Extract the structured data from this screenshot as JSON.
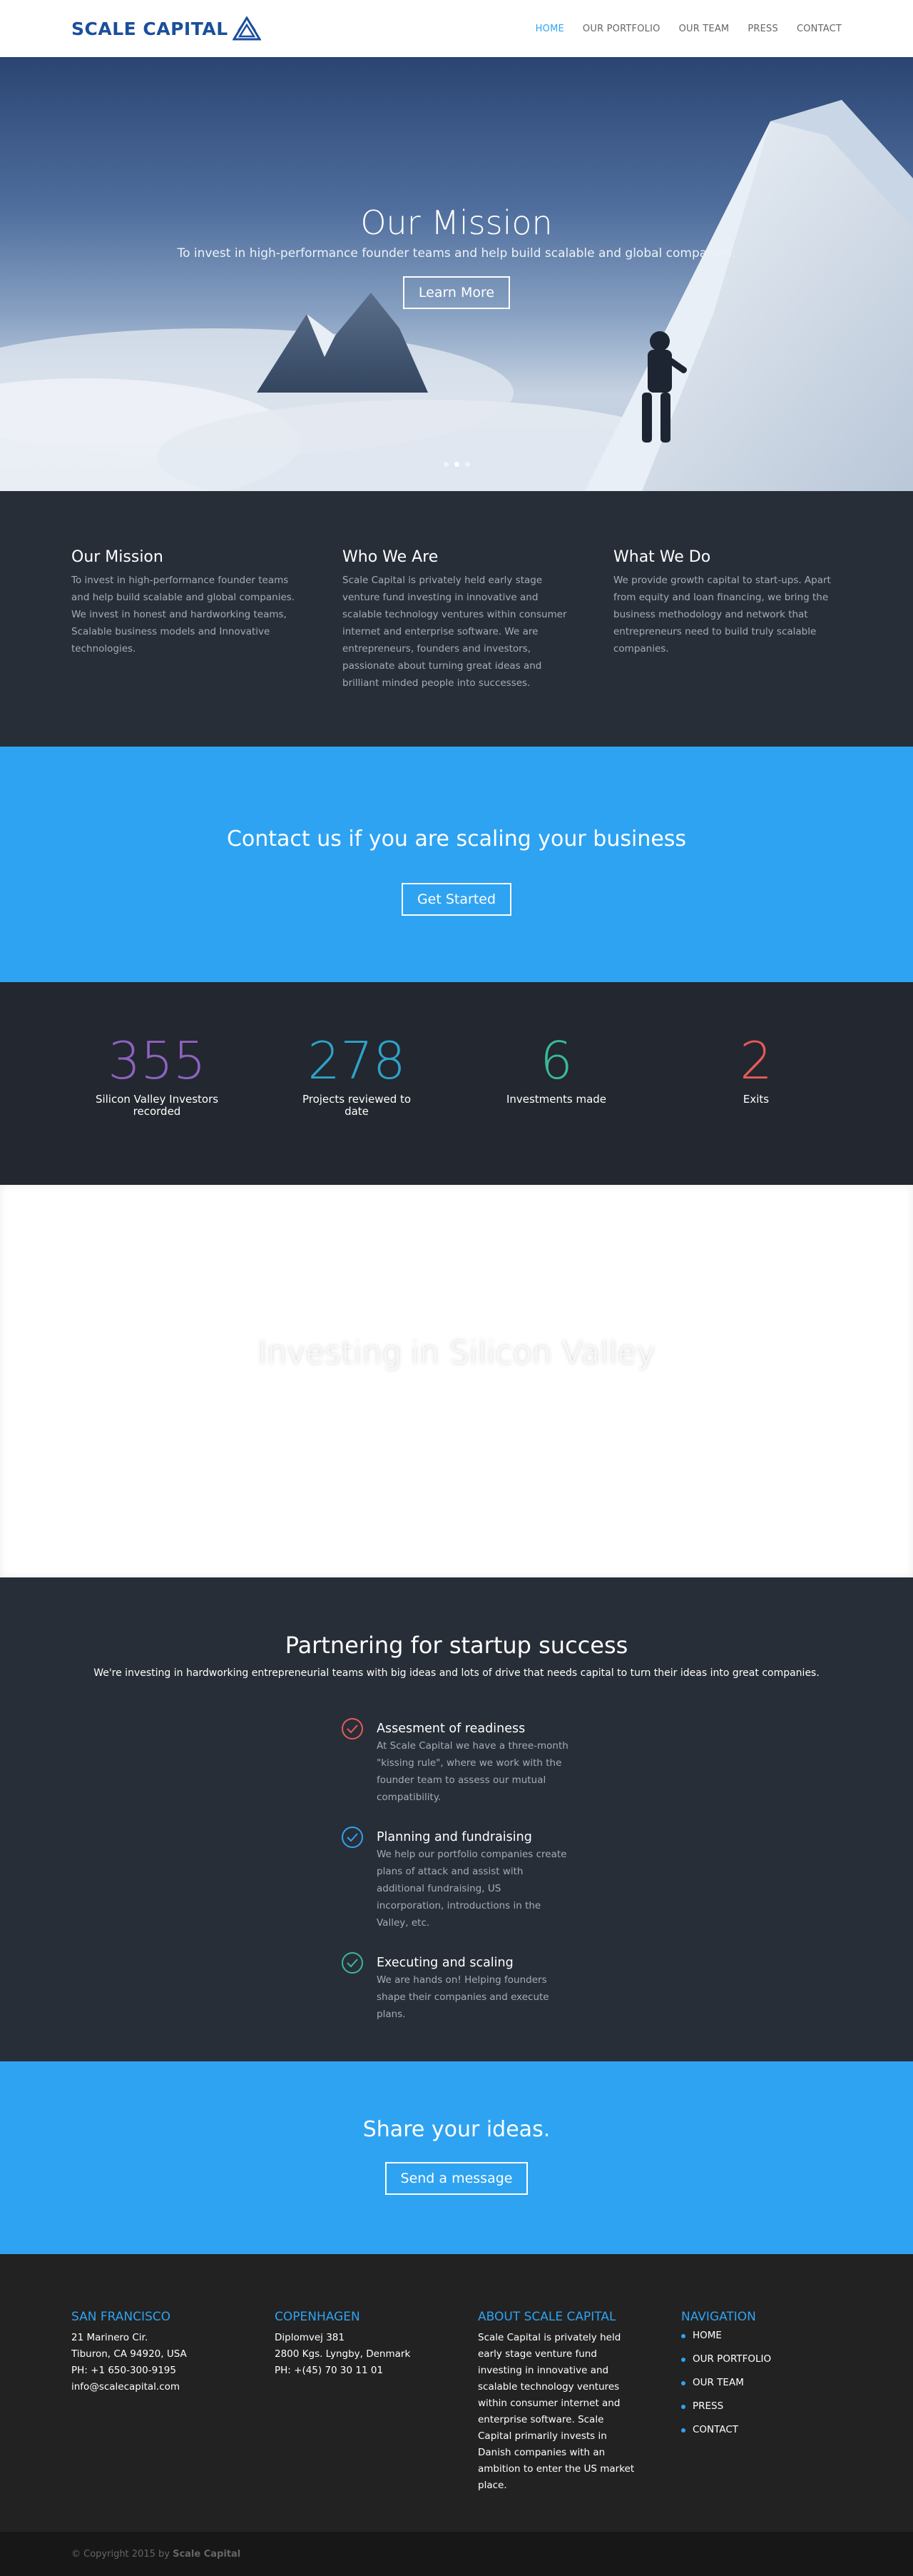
{
  "header": {
    "logo_text": "SCALE CAPITAL",
    "nav": [
      {
        "label": "HOME",
        "active": true
      },
      {
        "label": "OUR PORTFOLIO",
        "active": false
      },
      {
        "label": "OUR TEAM",
        "active": false
      },
      {
        "label": "PRESS",
        "active": false
      },
      {
        "label": "CONTACT",
        "active": false
      }
    ]
  },
  "hero": {
    "title": "Our Mission",
    "subtitle": "To invest in high-performance founder teams and help build scalable and global companies.",
    "button": "Learn More",
    "slides": 3,
    "active_slide": 2
  },
  "info": [
    {
      "title": "Our Mission",
      "text": "To invest in high-performance founder teams and help build scalable and global companies. We invest in honest and hardworking teams, Scalable business models and Innovative technologies."
    },
    {
      "title": "Who We Are",
      "text": "Scale Capital is privately held early stage venture fund investing in innovative and scalable technology ventures within consumer internet and enterprise software. We are entrepreneurs, founders and investors, passionate about turning great ideas and brilliant minded people into successes."
    },
    {
      "title": "What We Do",
      "text": "We provide growth capital to start-ups. Apart from equity and loan financing, we bring the business methodology and network that entrepreneurs need to build truly scalable companies."
    }
  ],
  "cta1": {
    "title": "Contact us if you are scaling your business",
    "button": "Get Started"
  },
  "stats": [
    {
      "value": "355",
      "label": "Silicon Valley Investors recorded",
      "color": "#8f62c2"
    },
    {
      "value": "278",
      "label": "Projects reviewed to date",
      "color": "#2ea3c9"
    },
    {
      "value": "6",
      "label": "Investments made",
      "color": "#3ab89a"
    },
    {
      "value": "2",
      "label": "Exits",
      "color": "#e55a5a"
    }
  ],
  "investing": {
    "title": "Investing in Silicon Valley"
  },
  "partner": {
    "title": "Partnering for startup success",
    "subtitle": "We're investing in hardworking entrepreneurial teams with big ideas and lots of drive that needs capital to turn their ideas into great companies.",
    "steps": [
      {
        "title": "Assesment of readiness",
        "text": "At Scale Capital we have a three-month \"kissing rule\", where we work with the founder team to assess our mutual compatibility.",
        "color": "#e55a5a"
      },
      {
        "title": "Planning and fundraising",
        "text": "We help our portfolio companies create plans of attack and assist with additional fundraising, US incorporation, introductions in the Valley, etc.",
        "color": "#2ea3f2"
      },
      {
        "title": "Executing and scaling",
        "text": "We are hands on! Helping founders shape their companies and execute plans.",
        "color": "#3ab89a"
      }
    ]
  },
  "cta2": {
    "title": "Share your ideas.",
    "button": "Send a message"
  },
  "footer": {
    "sf": {
      "title": "SAN FRANCISCO",
      "lines": [
        "21 Marinero Cir.",
        "Tiburon, CA 94920, USA",
        "PH: +1 650-300-9195",
        "info@scalecapital.com"
      ]
    },
    "cph": {
      "title": "COPENHAGEN",
      "lines": [
        "Diplomvej 381",
        "2800 Kgs. Lyngby, Denmark",
        "PH: +(45) 70 30 11 01"
      ]
    },
    "about": {
      "title": "ABOUT SCALE CAPITAL",
      "text": "Scale Capital is privately held early stage venture fund investing in innovative and scalable technology ventures within consumer internet and enterprise software. Scale Capital primarily invests in Danish companies with an ambition to enter the US market place."
    },
    "nav": {
      "title": "NAVIGATION",
      "items": [
        "HOME",
        "OUR PORTFOLIO",
        "OUR TEAM",
        "PRESS",
        "CONTACT"
      ]
    }
  },
  "copyright": {
    "prefix": "© Copyright 2015 by ",
    "brand": "Scale Capital"
  }
}
